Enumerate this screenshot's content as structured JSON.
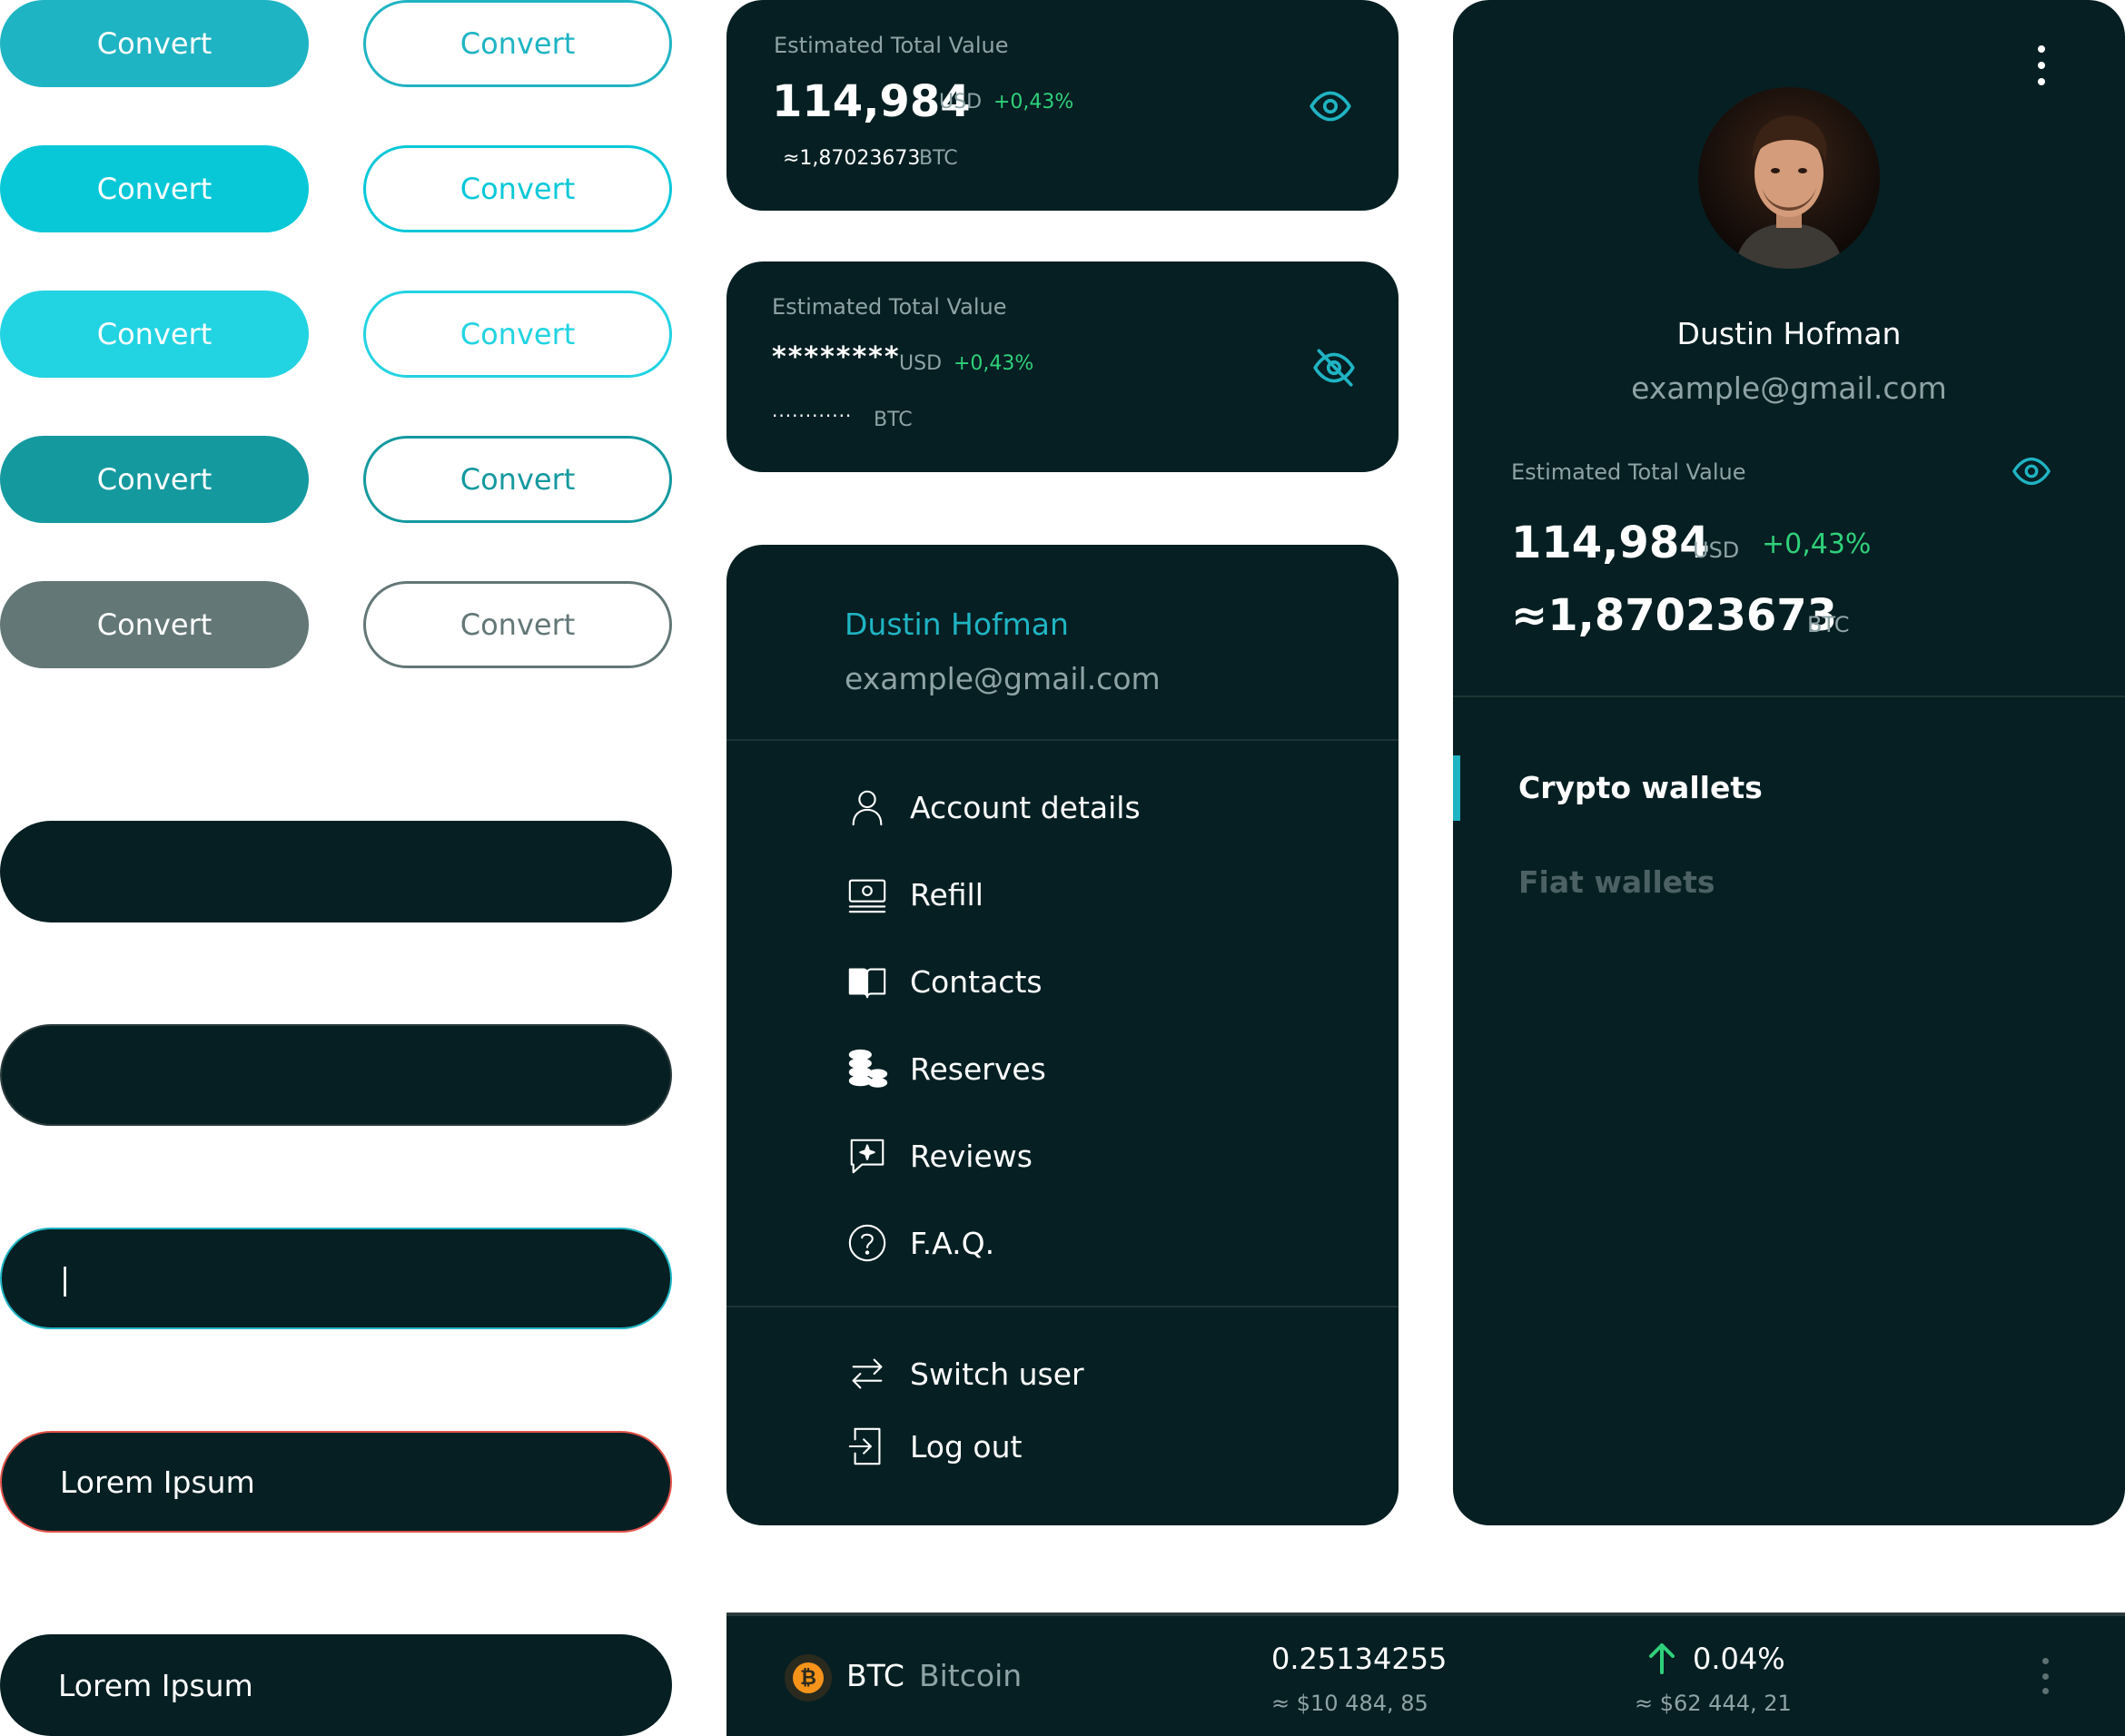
{
  "buttons": {
    "convert_label": "Convert",
    "rows": [
      {
        "filled_color": "#1fb4c3",
        "outline_color": "#1fb4c3"
      },
      {
        "filled_color": "#08c8d8",
        "outline_color": "#08c8d8"
      },
      {
        "filled_color": "#22d3e2",
        "outline_color": "#22d3e2"
      },
      {
        "filled_color": "#14999f",
        "outline_color": "#14999f"
      },
      {
        "filled_color": "#637777",
        "outline_color": "#637777"
      }
    ]
  },
  "inputs": {
    "cursor": "|",
    "error_value": "Lorem Ipsum",
    "filled_value": "Lorem Ipsum",
    "focus_border": "#1fb4c3",
    "error_border": "#e2524a"
  },
  "value_card": {
    "label": "Estimated Total Value",
    "amount": "114,984",
    "currency": "USD",
    "change": "+0,43%",
    "btc_approx": "≈1,87023673",
    "btc_unit": "BTC"
  },
  "value_card_hidden": {
    "label": "Estimated Total Value",
    "amount_masked": "********",
    "currency": "USD",
    "change": "+0,43%",
    "btc_masked": "............",
    "btc_unit": "BTC"
  },
  "menu": {
    "user_name": "Dustin Hofman",
    "user_email": "example@gmail.com",
    "items": [
      {
        "label": "Account details",
        "icon": "user-icon"
      },
      {
        "label": "Refill",
        "icon": "cash-icon"
      },
      {
        "label": "Contacts",
        "icon": "book-icon"
      },
      {
        "label": "Reserves",
        "icon": "coins-icon"
      },
      {
        "label": "Reviews",
        "icon": "review-icon"
      },
      {
        "label": "F.A.Q.",
        "icon": "help-icon"
      }
    ],
    "footer_items": [
      {
        "label": "Switch user",
        "icon": "switch-icon"
      },
      {
        "label": "Log out",
        "icon": "logout-icon"
      }
    ]
  },
  "profile": {
    "name": "Dustin Hofman",
    "email": "example@gmail.com",
    "value_label": "Estimated Total Value",
    "amount": "114,984",
    "currency": "USD",
    "change": "+0,43%",
    "btc_approx": "≈1,87023673",
    "btc_unit": "BTC",
    "tabs": [
      "Crypto wallets",
      "Fiat wallets"
    ],
    "active_tab": "Crypto wallets"
  },
  "coin_row": {
    "ticker": "BTC",
    "name": "Bitcoin",
    "amount": "0.25134255",
    "amount_fiat": "≈ $10 484, 85",
    "change": "0.04%",
    "price_fiat": "≈ $62 444, 21",
    "coin_color": "#f7931a"
  },
  "colors": {
    "dark": "#061f22",
    "accent": "#1fb4c3",
    "positive": "#2fd07a"
  }
}
